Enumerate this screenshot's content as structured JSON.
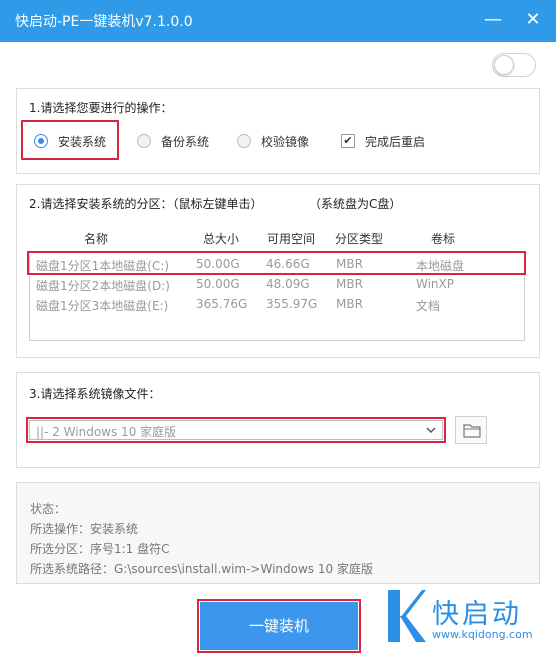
{
  "window": {
    "title": "快启动-PE一键装机v7.1.0.0",
    "minimize_glyph": "—",
    "close_glyph": "✕"
  },
  "toggle": {
    "state": "off"
  },
  "section1": {
    "title": "1.请选择您要进行的操作：",
    "options": [
      {
        "label": "安装系统",
        "selected": true
      },
      {
        "label": "备份系统",
        "selected": false
      },
      {
        "label": "校验镜像",
        "selected": false
      }
    ],
    "reboot_checkbox": {
      "label": "完成后重启",
      "checked": true
    }
  },
  "section2": {
    "title": "2.请选择安装系统的分区：（鼠标左键单击）",
    "note": "（系统盘为C盘）",
    "columns": [
      "名称",
      "总大小",
      "可用空间",
      "分区类型",
      "卷标"
    ],
    "rows": [
      [
        "磁盘1分区1本地磁盘(C:)",
        "50.00G",
        "46.66G",
        "MBR",
        "本地磁盘"
      ],
      [
        "磁盘1分区2本地磁盘(D:)",
        "50.00G",
        "48.09G",
        "MBR",
        "WinXP"
      ],
      [
        "磁盘1分区3本地磁盘(E:)",
        "365.76G",
        "355.97G",
        "MBR",
        "文档"
      ]
    ]
  },
  "section3": {
    "title": "3.请选择系统镜像文件：",
    "selected_image": "||- 2 Windows  10 家庭版"
  },
  "status": {
    "heading": "状态：",
    "operation": "所选操作：安装系统",
    "partition": "所选分区：序号1:1    盘符C",
    "path": "所选系统路径：G:\\sources\\install.wim->Windows  10 家庭版"
  },
  "install_button": {
    "label": "一键装机"
  },
  "brand": {
    "name": "快启动",
    "url": "www.kqidong.com",
    "color": "#2b8fe8"
  },
  "colors": {
    "titlebar": "#2f9be8",
    "accent": "#3c96eb",
    "highlight_box": "#d6283c"
  }
}
